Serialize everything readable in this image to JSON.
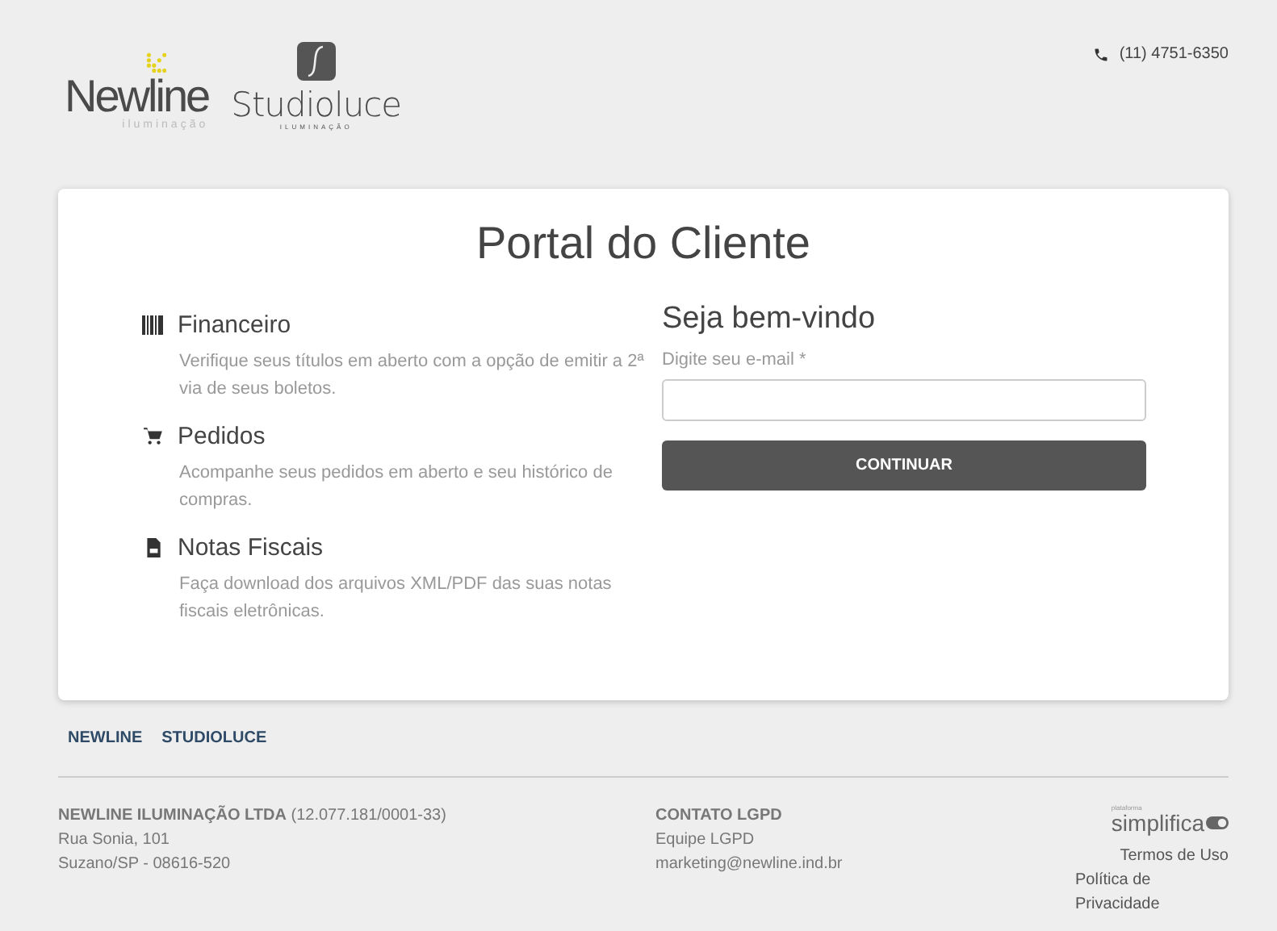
{
  "header": {
    "logos": [
      {
        "name": "Newline",
        "tagline": "iluminação"
      },
      {
        "name": "Studioluce",
        "tagline": "ILUMINAÇÃO"
      }
    ],
    "phone": "(11) 4751-6350"
  },
  "card": {
    "title": "Portal do Cliente",
    "features": [
      {
        "kind": "barcode",
        "title": "Financeiro",
        "text": "Verifique seus títulos em aberto com a opção de emitir a 2ª via de seus boletos."
      },
      {
        "kind": "cart",
        "title": "Pedidos",
        "text": "Acompanhe seus pedidos em aberto e seu histórico de compras."
      },
      {
        "kind": "document",
        "title": "Notas Fiscais",
        "text": "Faça download dos arquivos XML/PDF das suas notas fiscais eletrônicas."
      }
    ],
    "login": {
      "heading": "Seja bem-vindo",
      "label": "Digite seu e-mail *",
      "button": "CONTINUAR"
    }
  },
  "brand_links": [
    "NEWLINE",
    "STUDIOLUCE"
  ],
  "footer": {
    "company": [
      "**NEWLINE ILUMINAÇÃO LTDA** (12.077.181/0001-33)",
      "Rua Sonia, 101",
      "Suzano/SP - 08616-520"
    ],
    "contact": [
      "CONTATO LGPD",
      "Equipe LGPD",
      "marketing@newline.ind.br"
    ],
    "platform": {
      "small": "plataforma",
      "name": "simplifica"
    },
    "links": [
      "Termos de Uso",
      "Política de Privacidade"
    ]
  }
}
